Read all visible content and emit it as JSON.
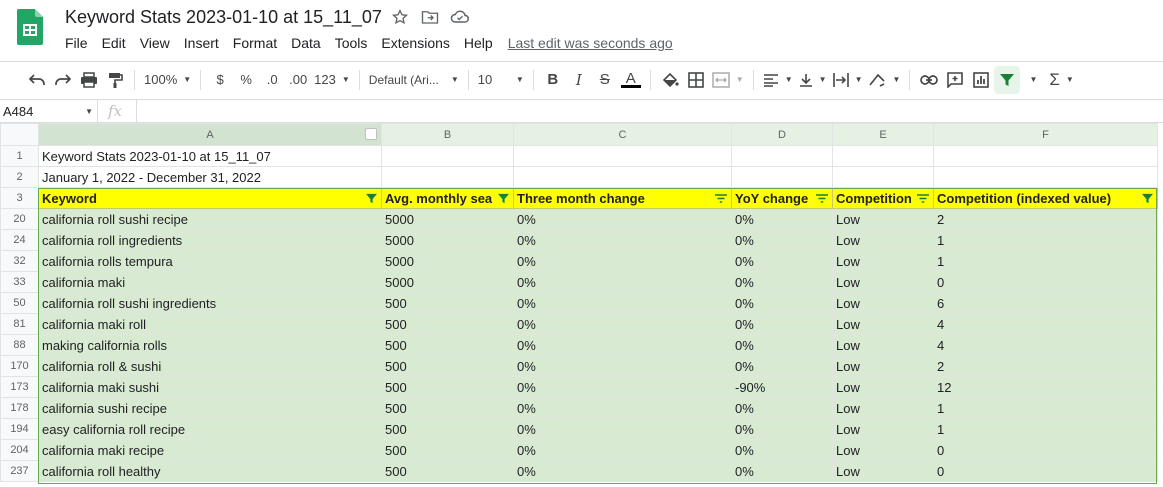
{
  "app": {
    "title": "Keyword Stats 2023-01-10 at 15_11_07",
    "menus": [
      "File",
      "Edit",
      "View",
      "Insert",
      "Format",
      "Data",
      "Tools",
      "Extensions",
      "Help"
    ],
    "last_edit": "Last edit was seconds ago"
  },
  "toolbar": {
    "zoom": "100%",
    "currency": "$",
    "percent": "%",
    "dec_decrease": ".0",
    "dec_increase": ".00",
    "more_formats": "123",
    "font": "Default (Ari...",
    "font_size": "10",
    "bold": "B",
    "italic": "I",
    "strike": "S",
    "text_color_letter": "A"
  },
  "formula_bar": {
    "name_box": "A484",
    "fx": "fx"
  },
  "colors": {
    "accent_green": "#188038",
    "header_yellow": "#ffff00",
    "band_green": "#d9ead3"
  },
  "sheet": {
    "columns": [
      "A",
      "B",
      "C",
      "D",
      "E",
      "F"
    ],
    "row_1": {
      "num": "1",
      "text": "Keyword Stats 2023-01-10 at 15_11_07"
    },
    "row_2": {
      "num": "2",
      "text": "January 1, 2022 - December 31, 2022"
    },
    "header_row": {
      "num": "3",
      "cells": [
        "Keyword",
        "Avg. monthly sea",
        "Three month change",
        "YoY change",
        "Competition",
        "Competition (indexed value)"
      ],
      "filter_active": [
        true,
        true,
        false,
        false,
        false,
        true
      ]
    },
    "rows": [
      {
        "num": "20",
        "cells": [
          "california roll sushi recipe",
          "5000",
          "0%",
          "0%",
          "Low",
          "2"
        ]
      },
      {
        "num": "24",
        "cells": [
          "california roll ingredients",
          "5000",
          "0%",
          "0%",
          "Low",
          "1"
        ]
      },
      {
        "num": "32",
        "cells": [
          "california rolls tempura",
          "5000",
          "0%",
          "0%",
          "Low",
          "1"
        ]
      },
      {
        "num": "33",
        "cells": [
          "california maki",
          "5000",
          "0%",
          "0%",
          "Low",
          "0"
        ]
      },
      {
        "num": "50",
        "cells": [
          "california roll sushi ingredients",
          "500",
          "0%",
          "0%",
          "Low",
          "6"
        ]
      },
      {
        "num": "81",
        "cells": [
          "california maki roll",
          "500",
          "0%",
          "0%",
          "Low",
          "4"
        ]
      },
      {
        "num": "88",
        "cells": [
          "making california rolls",
          "500",
          "0%",
          "0%",
          "Low",
          "4"
        ]
      },
      {
        "num": "170",
        "cells": [
          "california roll & sushi",
          "500",
          "0%",
          "0%",
          "Low",
          "2"
        ]
      },
      {
        "num": "173",
        "cells": [
          "california maki sushi",
          "500",
          "0%",
          "-90%",
          "Low",
          "12"
        ]
      },
      {
        "num": "178",
        "cells": [
          "california sushi recipe",
          "500",
          "0%",
          "0%",
          "Low",
          "1"
        ]
      },
      {
        "num": "194",
        "cells": [
          "easy california roll recipe",
          "500",
          "0%",
          "0%",
          "Low",
          "1"
        ]
      },
      {
        "num": "204",
        "cells": [
          "california maki recipe",
          "500",
          "0%",
          "0%",
          "Low",
          "0"
        ]
      },
      {
        "num": "237",
        "cells": [
          "california roll healthy",
          "500",
          "0%",
          "0%",
          "Low",
          "0"
        ]
      }
    ]
  }
}
